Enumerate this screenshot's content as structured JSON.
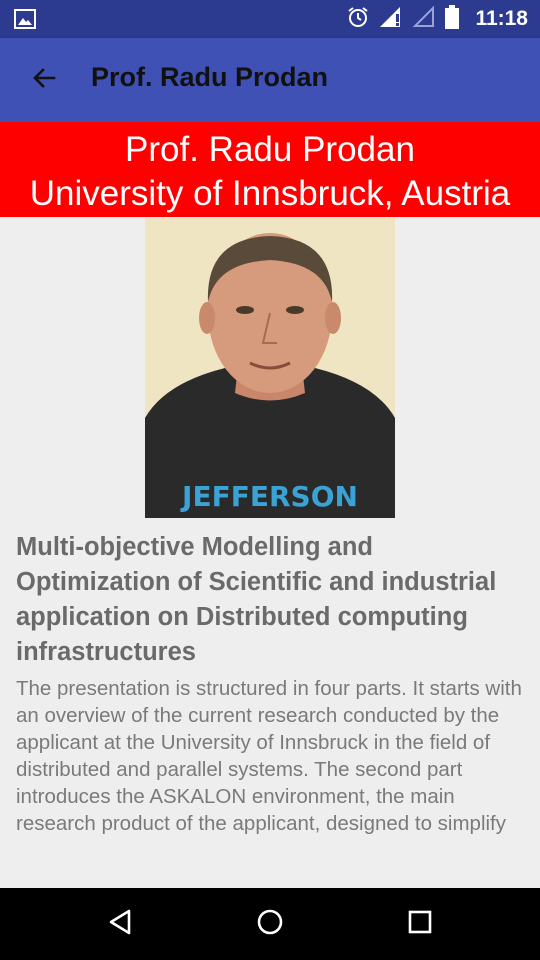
{
  "status_bar": {
    "time": "11:18",
    "icons": [
      "image-notification-icon",
      "alarm-icon",
      "signal-icon",
      "signal-empty-icon",
      "battery-icon"
    ]
  },
  "app_bar": {
    "title": "Prof. Radu Prodan",
    "back_icon": "arrow-left-icon"
  },
  "banner": {
    "line1": "Prof. Radu Prodan",
    "line2": "University of Innsbruck, Austria",
    "background": "#ff0000"
  },
  "talk": {
    "title": "Multi-objective Modelling and Optimization of Scientific and industrial application on Distributed computing infrastructures",
    "abstract": "The presentation is structured in four parts. It starts with an overview of the current research conducted by the applicant at the University of Innsbruck in the field of distributed and parallel systems. The second part introduces the ASKALON environment, the main research product of the applicant, designed to simplify"
  },
  "photo": {
    "shirt_text": "JEFFERSON"
  },
  "nav_bar": {
    "icons": [
      "back-triangle-icon",
      "home-circle-icon",
      "recents-square-icon"
    ]
  },
  "colors": {
    "status_bar": "#2c3a8f",
    "app_bar": "#3f51b5",
    "background": "#eeeeee",
    "text_title": "#6a6a6a",
    "text_body": "#7a7a7a"
  }
}
